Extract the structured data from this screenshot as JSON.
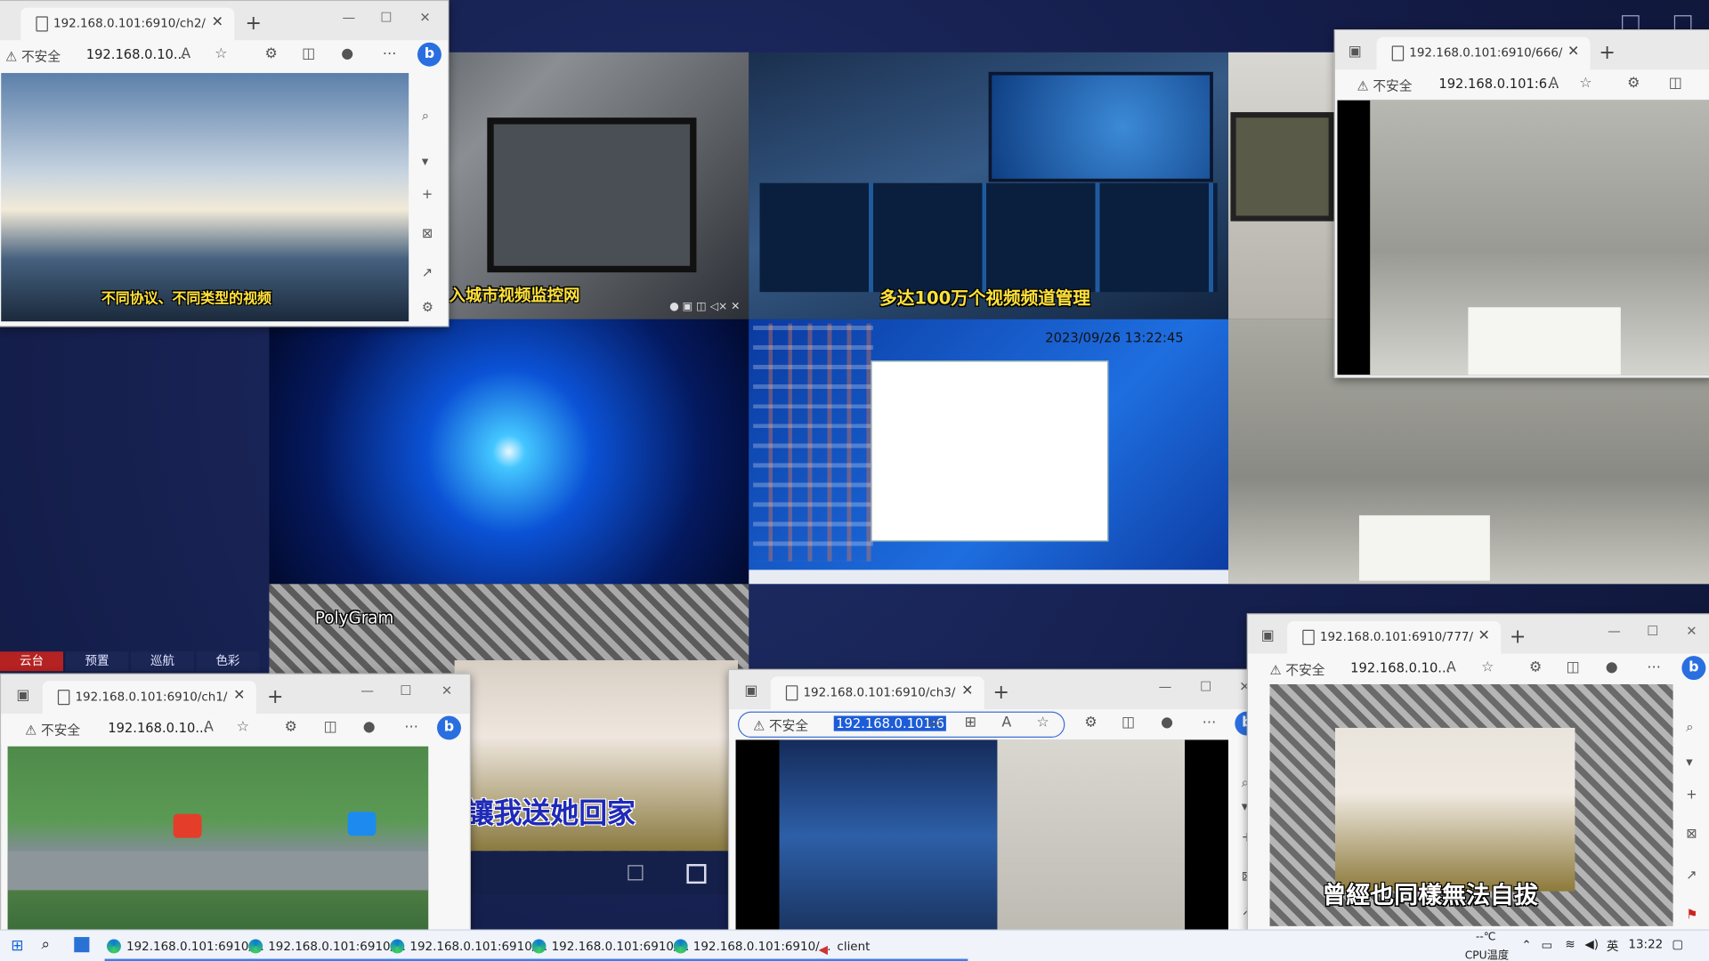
{
  "wall": {
    "tile_ch2_caption": "不同协议、不同类型的视频",
    "tile_monitor_caption": "入城市视频监控网",
    "tile_control_caption": "多达100万个视频频道管理",
    "desktop_timestamp": "2023/09/26 13:22:45",
    "polygram_logo": "PolyGram",
    "karaoke_caption": "讓我送她回家",
    "bottom_tabs": [
      "云台",
      "预置",
      "巡航",
      "色彩"
    ]
  },
  "windows": {
    "ch2": {
      "tab_title": "192.168.0.101:6910/ch2/",
      "insecure": "不安全",
      "url": "192.168.0.10..."
    },
    "w666": {
      "tab_title": "192.168.0.101:6910/666/",
      "insecure": "不安全",
      "url": "192.168.0.101:6..."
    },
    "ch1": {
      "tab_title": "192.168.0.101:6910/ch1/",
      "insecure": "不安全",
      "url": "192.168.0.10..."
    },
    "ch3": {
      "tab_title": "192.168.0.101:6910/ch3/",
      "insecure": "不安全",
      "url": "192.168.0.101:6"
    },
    "w777": {
      "tab_title": "192.168.0.101:6910/777/",
      "insecure": "不安全",
      "url": "192.168.0.10...",
      "caption": "曾經也同樣無法自拔"
    }
  },
  "taskbar": {
    "items": [
      "192.168.0.101:6910/...",
      "192.168.0.101:6910/...",
      "192.168.0.101:6910/...",
      "192.168.0.101:6910/...",
      "192.168.0.101:6910/...",
      "client"
    ],
    "temp": "--℃",
    "cpu_label": "CPU温度",
    "ime": "英",
    "time": "13:22"
  }
}
